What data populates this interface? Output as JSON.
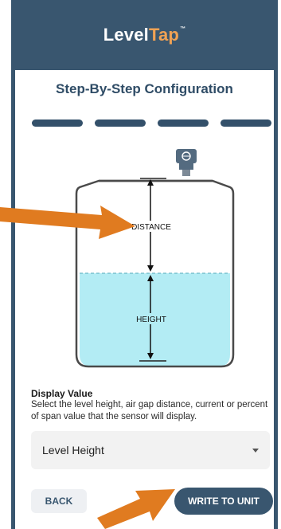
{
  "header": {
    "logo_part1": "Level",
    "logo_part2": "Tap",
    "logo_tm": "™"
  },
  "title": "Step-By-Step Configuration",
  "steps": {
    "count": 4,
    "current": 4
  },
  "diagram": {
    "distance_label": "DISTANCE",
    "height_label": "HEIGHT"
  },
  "display_value": {
    "label": "Display Value",
    "description": "Select the level height, air gap distance, current or percent of span value that the sensor will display.",
    "selected": "Level Height"
  },
  "buttons": {
    "back": "BACK",
    "write": "WRITE TO UNIT"
  },
  "colors": {
    "header": "#39566f",
    "accent_orange": "#e07b20",
    "liquid": "#b3ecf4",
    "logo_accent": "#f0a254"
  }
}
